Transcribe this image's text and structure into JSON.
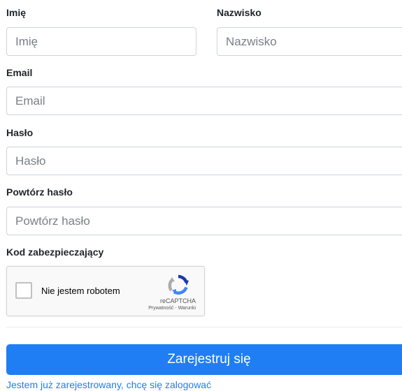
{
  "form": {
    "first_name": {
      "label": "Imię",
      "placeholder": "Imię"
    },
    "last_name": {
      "label": "Nazwisko",
      "placeholder": "Nazwisko"
    },
    "email": {
      "label": "Email",
      "placeholder": "Email"
    },
    "password": {
      "label": "Hasło",
      "placeholder": "Hasło"
    },
    "password_repeat": {
      "label": "Powtórz hasło",
      "placeholder": "Powtórz hasło"
    },
    "captcha_label": "Kod zabezpieczający"
  },
  "recaptcha": {
    "checkbox_text": "Nie jestem robotem",
    "brand": "reCAPTCHA",
    "links": "Prywatność - Warunki"
  },
  "submit_label": "Zarejestruj się",
  "login_link": "Jestem już zarejestrowany, chcę się zalogować",
  "colors": {
    "primary": "#1f7ef4",
    "input_border": "#ced4da",
    "placeholder": "#7a8087"
  }
}
